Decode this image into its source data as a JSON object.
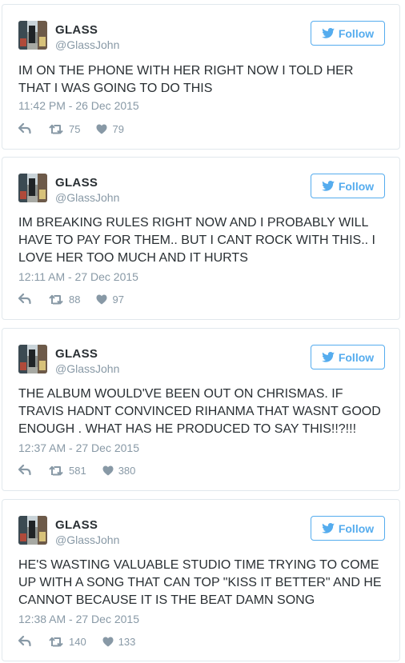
{
  "colors": {
    "accent": "#55acee",
    "muted": "#8899a6",
    "text": "#292f33",
    "border": "#e1e8ed"
  },
  "tweets": [
    {
      "name": "GLASS",
      "handle": "@GlassJohn",
      "follow_label": "Follow",
      "text": "IM ON THE PHONE WITH HER RIGHT NOW I TOLD HER THAT I WAS GOING TO DO THIS",
      "timestamp": "11:42 PM - 26 Dec 2015",
      "retweets": "75",
      "likes": "79"
    },
    {
      "name": "GLASS",
      "handle": "@GlassJohn",
      "follow_label": "Follow",
      "text": "IM BREAKING RULES RIGHT NOW AND I PROBABLY WILL HAVE TO PAY FOR THEM.. BUT I CANT ROCK WITH THIS.. I LOVE HER TOO MUCH AND IT HURTS",
      "timestamp": "12:11 AM - 27 Dec 2015",
      "retweets": "88",
      "likes": "97"
    },
    {
      "name": "GLASS",
      "handle": "@GlassJohn",
      "follow_label": "Follow",
      "text": "THE ALBUM WOULD'VE BEEN OUT ON CHRISMAS. IF TRAVIS HADNT CONVINCED RIHANMA THAT WASNT GOOD ENOUGH . WHAT HAS HE PRODUCED TO SAY THIS!!?!!!",
      "timestamp": "12:37 AM - 27 Dec 2015",
      "retweets": "581",
      "likes": "380"
    },
    {
      "name": "GLASS",
      "handle": "@GlassJohn",
      "follow_label": "Follow",
      "text": "HE'S WASTING VALUABLE STUDIO TIME TRYING TO COME UP WITH A SONG THAT CAN TOP \"KISS IT BETTER\" AND HE CANNOT BECAUSE IT IS THE BEAT DAMN SONG",
      "timestamp": "12:38 AM - 27 Dec 2015",
      "retweets": "140",
      "likes": "133"
    }
  ]
}
